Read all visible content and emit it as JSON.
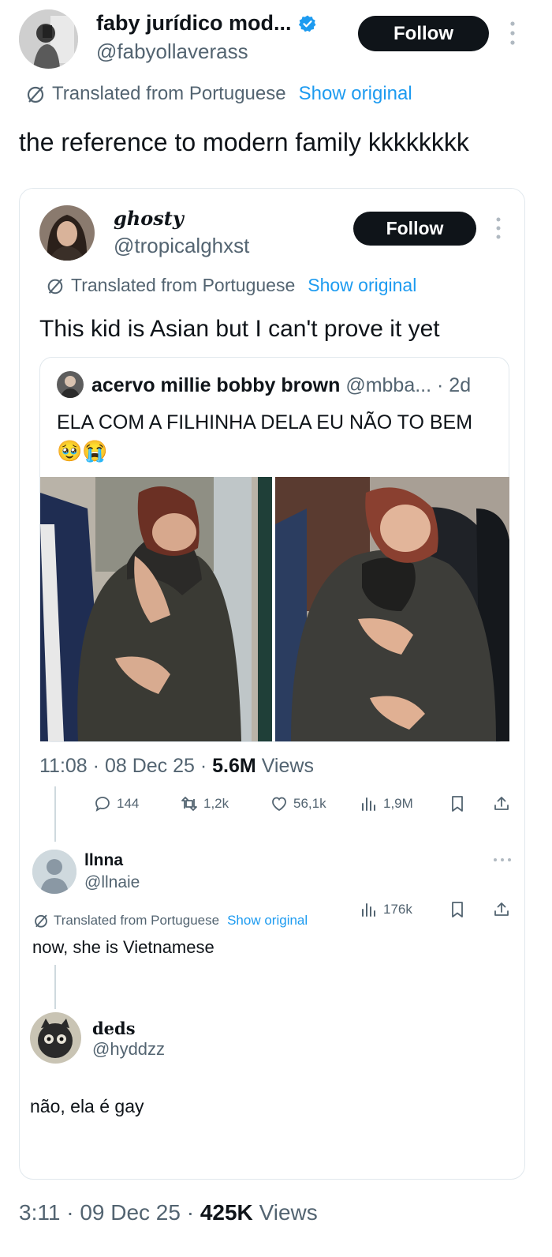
{
  "main_tweet": {
    "author_name": "faby jurídico mod...",
    "handle": "@fabyollaverass",
    "follow_label": "Follow",
    "translated_label": "Translated from Portuguese",
    "show_original_label": "Show original",
    "text": "the reference to modern family kkkkkkkk",
    "time": "3:11",
    "date": "09 Dec 25",
    "views_count": "425K",
    "views_label": "Views"
  },
  "quoted_tweet": {
    "author_name": "ghosty",
    "handle": "@tropicalghxst",
    "follow_label": "Follow",
    "translated_label": "Translated from Portuguese",
    "show_original_label": "Show original",
    "text": "This kid is Asian but I can't prove it yet",
    "time": "11:08",
    "date": "08 Dec 25",
    "views_count": "5.6M",
    "views_label": "Views",
    "stats": {
      "replies": "144",
      "retweets": "1,2k",
      "likes": "56,1k",
      "views": "1,9M"
    }
  },
  "nested_quote": {
    "author_name": "acervo millie bobby brown",
    "handle": "@mbba...",
    "age": "· 2d",
    "text": "ELA COM A FILHINHA DELA EU NÃO TO BEM",
    "emoji": "🥹😭"
  },
  "reply_1": {
    "author_name": "llnna",
    "handle": "@llnaie",
    "translated_label": "Translated from Portuguese",
    "show_original_label": "Show original",
    "text": "now, she is Vietnamese",
    "views": "176k"
  },
  "reply_2": {
    "author_name": "deds",
    "handle": "@hyddzz",
    "text": "não, ela é gay"
  },
  "icons": [
    "verified-badge-icon",
    "translate-icon",
    "reply-icon",
    "retweet-icon",
    "like-icon",
    "views-icon",
    "bookmark-icon",
    "share-icon",
    "more-icon"
  ],
  "colors": {
    "accent": "#1d9bf0",
    "text": "#0f1419",
    "muted": "#536471",
    "button": "#0f1419"
  }
}
